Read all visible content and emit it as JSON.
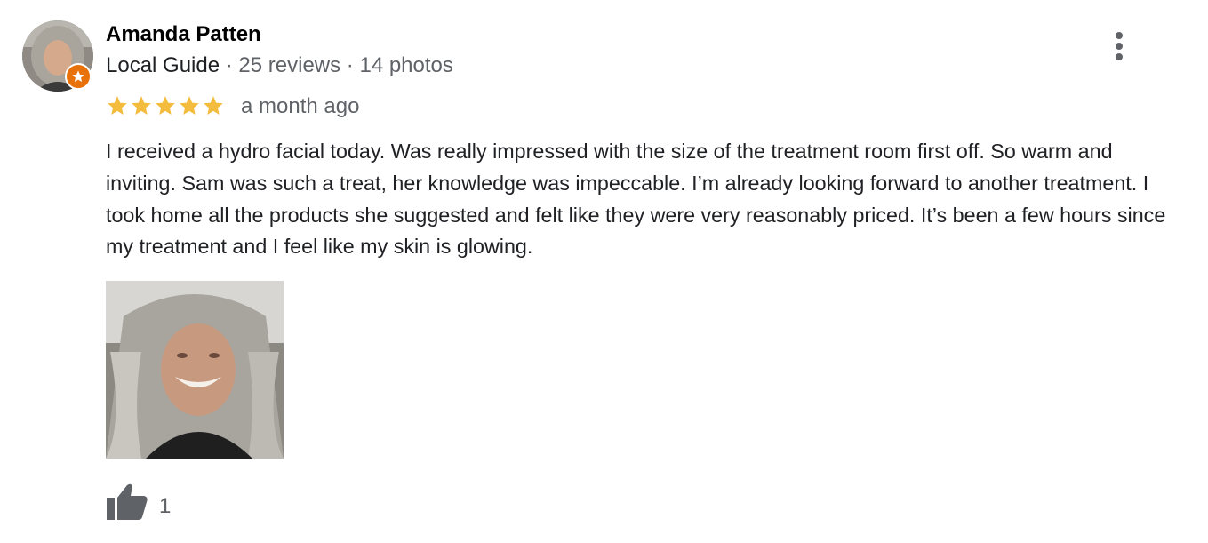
{
  "review": {
    "author": {
      "name": "Amanda Patten",
      "role": "Local Guide",
      "reviews": "25 reviews",
      "photos": "14 photos",
      "separator": " · "
    },
    "rating": 5,
    "rating_max": 5,
    "date": "a month ago",
    "text": "I received a hydro facial today. Was really impressed with the size of the treatment room first off. So warm and inviting. Sam was such a treat, her knowledge was impeccable. I’m already looking forward to another treatment. I took home all the products she suggested and felt like they were very reasonably priced. It’s been a few hours since my treatment and I feel like my skin is glowing.",
    "like_count": "1",
    "icons": {
      "more": "more-vert-icon",
      "like": "thumb-up-icon",
      "badge": "local-guide-star-icon",
      "star": "star-icon"
    },
    "colors": {
      "star": "#f4bc3c",
      "badge": "#e8710a",
      "meta_text": "#5f6368",
      "body_text": "#202124"
    }
  }
}
